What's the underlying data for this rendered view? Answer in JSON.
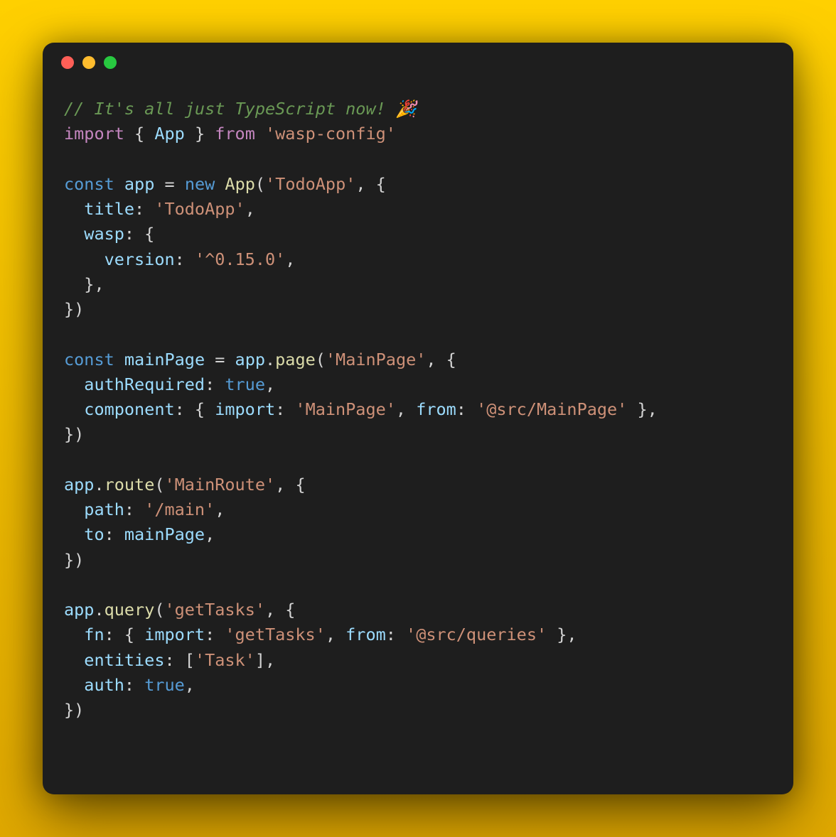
{
  "window": {
    "colors": {
      "red": "#ff5f57",
      "yellow": "#febc2e",
      "green": "#28c840"
    }
  },
  "code": {
    "lines": [
      [
        {
          "c": "comment",
          "t": "// It's all just TypeScript now! 🎉"
        }
      ],
      [
        {
          "c": "keyword",
          "t": "import"
        },
        {
          "c": "punct",
          "t": " { "
        },
        {
          "c": "ident",
          "t": "App"
        },
        {
          "c": "punct",
          "t": " } "
        },
        {
          "c": "keyword",
          "t": "from"
        },
        {
          "c": "punct",
          "t": " "
        },
        {
          "c": "string",
          "t": "'wasp-config'"
        }
      ],
      [],
      [
        {
          "c": "type",
          "t": "const"
        },
        {
          "c": "punct",
          "t": " "
        },
        {
          "c": "ident",
          "t": "app"
        },
        {
          "c": "punct",
          "t": " = "
        },
        {
          "c": "new",
          "t": "new"
        },
        {
          "c": "punct",
          "t": " "
        },
        {
          "c": "func",
          "t": "App"
        },
        {
          "c": "punct",
          "t": "("
        },
        {
          "c": "string",
          "t": "'TodoApp'"
        },
        {
          "c": "punct",
          "t": ", {"
        }
      ],
      [
        {
          "c": "punct",
          "t": "  "
        },
        {
          "c": "ident",
          "t": "title"
        },
        {
          "c": "punct",
          "t": ": "
        },
        {
          "c": "string",
          "t": "'TodoApp'"
        },
        {
          "c": "punct",
          "t": ","
        }
      ],
      [
        {
          "c": "punct",
          "t": "  "
        },
        {
          "c": "ident",
          "t": "wasp"
        },
        {
          "c": "punct",
          "t": ": {"
        }
      ],
      [
        {
          "c": "punct",
          "t": "    "
        },
        {
          "c": "ident",
          "t": "version"
        },
        {
          "c": "punct",
          "t": ": "
        },
        {
          "c": "string",
          "t": "'^0.15.0'"
        },
        {
          "c": "punct",
          "t": ","
        }
      ],
      [
        {
          "c": "punct",
          "t": "  },"
        }
      ],
      [
        {
          "c": "punct",
          "t": "})"
        }
      ],
      [],
      [
        {
          "c": "type",
          "t": "const"
        },
        {
          "c": "punct",
          "t": " "
        },
        {
          "c": "ident",
          "t": "mainPage"
        },
        {
          "c": "punct",
          "t": " = "
        },
        {
          "c": "ident",
          "t": "app"
        },
        {
          "c": "punct",
          "t": "."
        },
        {
          "c": "func",
          "t": "page"
        },
        {
          "c": "punct",
          "t": "("
        },
        {
          "c": "string",
          "t": "'MainPage'"
        },
        {
          "c": "punct",
          "t": ", {"
        }
      ],
      [
        {
          "c": "punct",
          "t": "  "
        },
        {
          "c": "ident",
          "t": "authRequired"
        },
        {
          "c": "punct",
          "t": ": "
        },
        {
          "c": "bool",
          "t": "true"
        },
        {
          "c": "punct",
          "t": ","
        }
      ],
      [
        {
          "c": "punct",
          "t": "  "
        },
        {
          "c": "ident",
          "t": "component"
        },
        {
          "c": "punct",
          "t": ": { "
        },
        {
          "c": "ident",
          "t": "import"
        },
        {
          "c": "punct",
          "t": ": "
        },
        {
          "c": "string",
          "t": "'MainPage'"
        },
        {
          "c": "punct",
          "t": ", "
        },
        {
          "c": "ident",
          "t": "from"
        },
        {
          "c": "punct",
          "t": ": "
        },
        {
          "c": "string",
          "t": "'@src/MainPage'"
        },
        {
          "c": "punct",
          "t": " },"
        }
      ],
      [
        {
          "c": "punct",
          "t": "})"
        }
      ],
      [],
      [
        {
          "c": "ident",
          "t": "app"
        },
        {
          "c": "punct",
          "t": "."
        },
        {
          "c": "func",
          "t": "route"
        },
        {
          "c": "punct",
          "t": "("
        },
        {
          "c": "string",
          "t": "'MainRoute'"
        },
        {
          "c": "punct",
          "t": ", {"
        }
      ],
      [
        {
          "c": "punct",
          "t": "  "
        },
        {
          "c": "ident",
          "t": "path"
        },
        {
          "c": "punct",
          "t": ": "
        },
        {
          "c": "string",
          "t": "'/main'"
        },
        {
          "c": "punct",
          "t": ","
        }
      ],
      [
        {
          "c": "punct",
          "t": "  "
        },
        {
          "c": "ident",
          "t": "to"
        },
        {
          "c": "punct",
          "t": ": "
        },
        {
          "c": "ident",
          "t": "mainPage"
        },
        {
          "c": "punct",
          "t": ","
        }
      ],
      [
        {
          "c": "punct",
          "t": "})"
        }
      ],
      [],
      [
        {
          "c": "ident",
          "t": "app"
        },
        {
          "c": "punct",
          "t": "."
        },
        {
          "c": "func",
          "t": "query"
        },
        {
          "c": "punct",
          "t": "("
        },
        {
          "c": "string",
          "t": "'getTasks'"
        },
        {
          "c": "punct",
          "t": ", {"
        }
      ],
      [
        {
          "c": "punct",
          "t": "  "
        },
        {
          "c": "ident",
          "t": "fn"
        },
        {
          "c": "punct",
          "t": ": { "
        },
        {
          "c": "ident",
          "t": "import"
        },
        {
          "c": "punct",
          "t": ": "
        },
        {
          "c": "string",
          "t": "'getTasks'"
        },
        {
          "c": "punct",
          "t": ", "
        },
        {
          "c": "ident",
          "t": "from"
        },
        {
          "c": "punct",
          "t": ": "
        },
        {
          "c": "string",
          "t": "'@src/queries'"
        },
        {
          "c": "punct",
          "t": " },"
        }
      ],
      [
        {
          "c": "punct",
          "t": "  "
        },
        {
          "c": "ident",
          "t": "entities"
        },
        {
          "c": "punct",
          "t": ": ["
        },
        {
          "c": "string",
          "t": "'Task'"
        },
        {
          "c": "punct",
          "t": "],"
        }
      ],
      [
        {
          "c": "punct",
          "t": "  "
        },
        {
          "c": "ident",
          "t": "auth"
        },
        {
          "c": "punct",
          "t": ": "
        },
        {
          "c": "bool",
          "t": "true"
        },
        {
          "c": "punct",
          "t": ","
        }
      ],
      [
        {
          "c": "punct",
          "t": "})"
        }
      ]
    ]
  }
}
